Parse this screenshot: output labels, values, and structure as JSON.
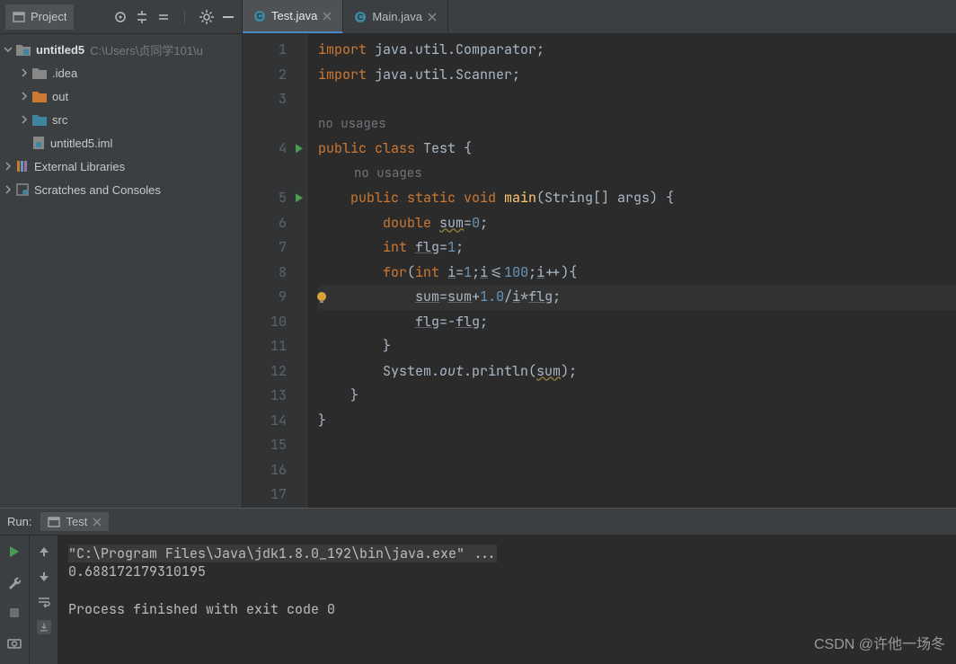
{
  "sidebar": {
    "title": "Project",
    "root": {
      "label": "untitled5",
      "path": "C:\\Users\\贞同学101\\u"
    },
    "items": [
      {
        "label": ".idea",
        "color": "#878787"
      },
      {
        "label": "out",
        "color": "#c97930"
      },
      {
        "label": "src",
        "color": "#3e86a0"
      }
    ],
    "file": "untitled5.iml",
    "external": "External Libraries",
    "scratches": "Scratches and Consoles"
  },
  "tabs": [
    {
      "label": "Test.java",
      "active": true
    },
    {
      "label": "Main.java",
      "active": false
    }
  ],
  "hints": {
    "no_usages": "no usages"
  },
  "code": {
    "l1": "import java.util.Comparator;",
    "l2": "import java.util.Scanner;",
    "l4": "public class Test {",
    "l5": "    public static void main(String[] args) {",
    "l6": "        double sum=0;",
    "l7": "        int flg=1;",
    "l8": "        for(int i=1;i<=100;i++){",
    "l9": "            sum=sum+1.0/i*flg;",
    "l10": "            flg=-flg;",
    "l11": "        }",
    "l12": "        System.out.println(sum);",
    "l13": "    }",
    "l14": "}"
  },
  "line_numbers": [
    "1",
    "2",
    "3",
    "4",
    "5",
    "6",
    "7",
    "8",
    "9",
    "10",
    "11",
    "12",
    "13",
    "14",
    "15",
    "16",
    "17"
  ],
  "run": {
    "panelLabel": "Run:",
    "tabName": "Test",
    "cmd": "\"C:\\Program Files\\Java\\jdk1.8.0_192\\bin\\java.exe\" ...",
    "output": "0.688172179310195",
    "exit": "Process finished with exit code 0"
  },
  "watermark": "CSDN @许他一场冬"
}
